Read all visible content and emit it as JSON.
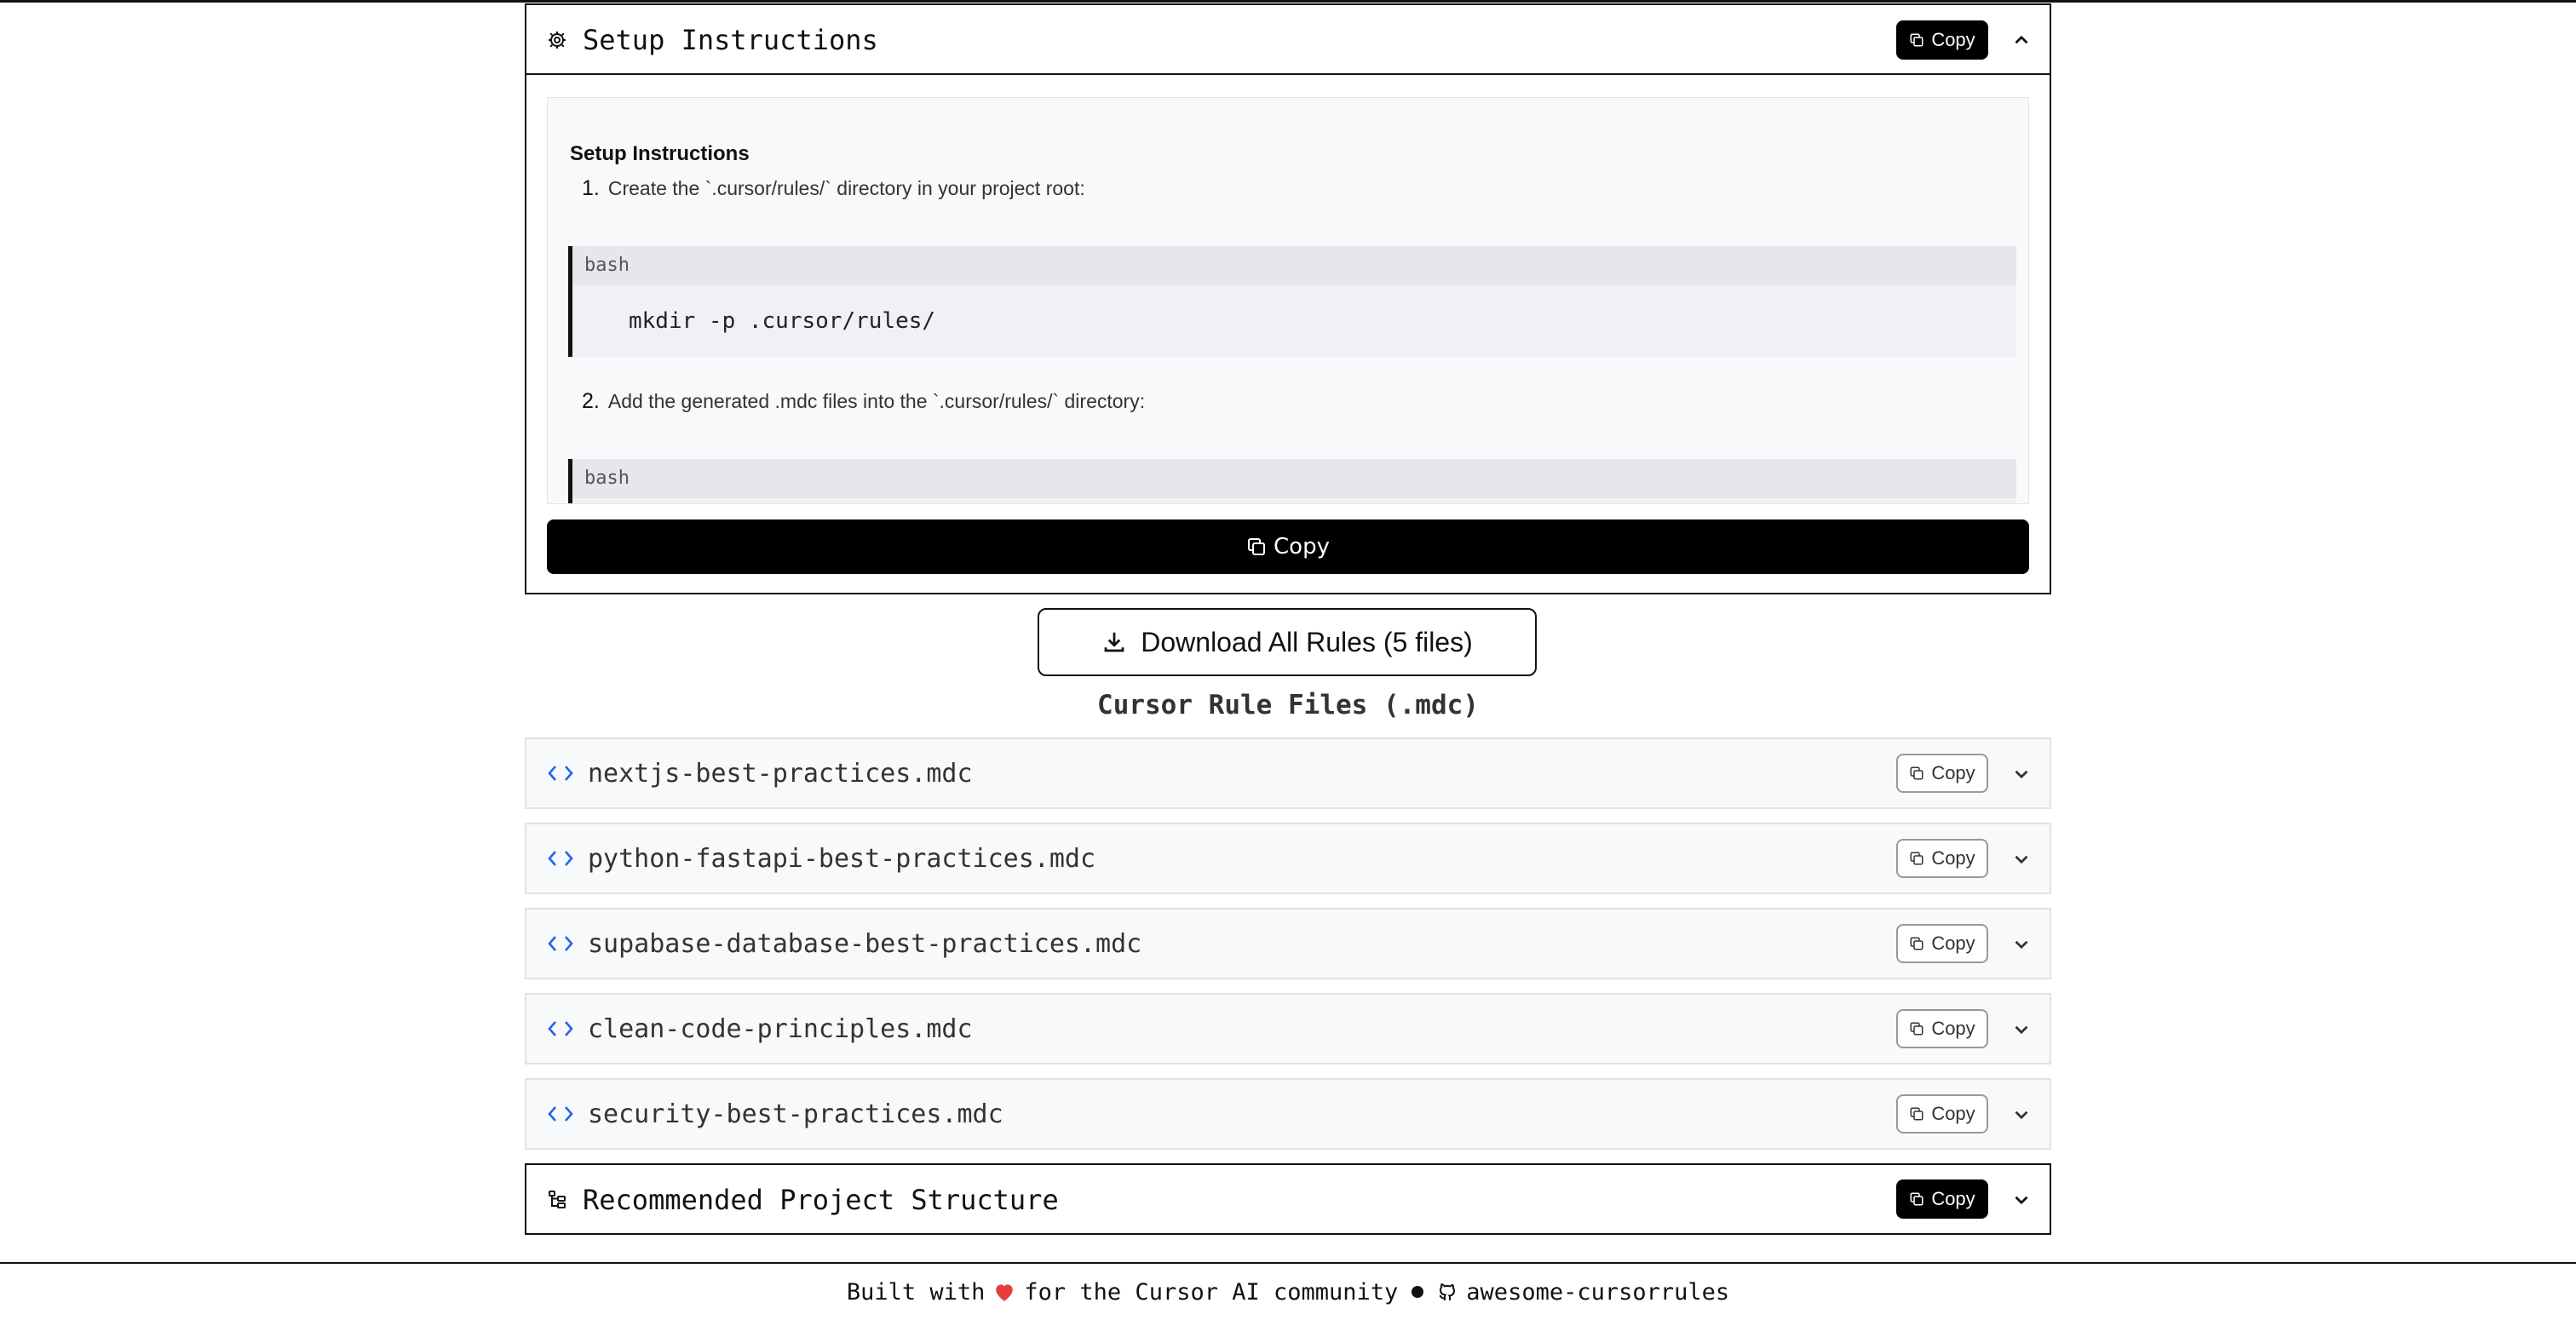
{
  "setup": {
    "title": "Setup Instructions",
    "copy_label": "Copy",
    "content": {
      "heading": "Setup Instructions",
      "steps": [
        {
          "num": "1.",
          "text": "Create the `.cursor/rules/` directory in your project root:",
          "lang": "bash",
          "code": "mkdir -p .cursor/rules/"
        },
        {
          "num": "2.",
          "text": "Add the generated .mdc files into the `.cursor/rules/` directory:",
          "lang": "bash"
        }
      ]
    },
    "wide_copy_label": "Copy"
  },
  "download": {
    "label": "Download All Rules (5 files)"
  },
  "rules_section": {
    "title": "Cursor Rule Files (.mdc)",
    "files": [
      {
        "name": "nextjs-best-practices.mdc",
        "copy_label": "Copy"
      },
      {
        "name": "python-fastapi-best-practices.mdc",
        "copy_label": "Copy"
      },
      {
        "name": "supabase-database-best-practices.mdc",
        "copy_label": "Copy"
      },
      {
        "name": "clean-code-principles.mdc",
        "copy_label": "Copy"
      },
      {
        "name": "security-best-practices.mdc",
        "copy_label": "Copy"
      }
    ]
  },
  "project": {
    "title": "Recommended Project Structure",
    "copy_label": "Copy"
  },
  "footer": {
    "prefix": "Built with",
    "suffix": "for the Cursor AI community",
    "link": "awesome-cursorrules"
  },
  "icons": {
    "setup": "gear-icon",
    "copy": "copy-icon",
    "collapse": "chevron-up-icon",
    "expand": "chevron-down-icon",
    "download": "download-icon",
    "file": "code-icon",
    "project": "folder-tree-icon",
    "heart": "heart-icon",
    "github": "github-icon"
  },
  "colors": {
    "accent_blue": "#2563eb",
    "heart": "#e53e3e"
  }
}
